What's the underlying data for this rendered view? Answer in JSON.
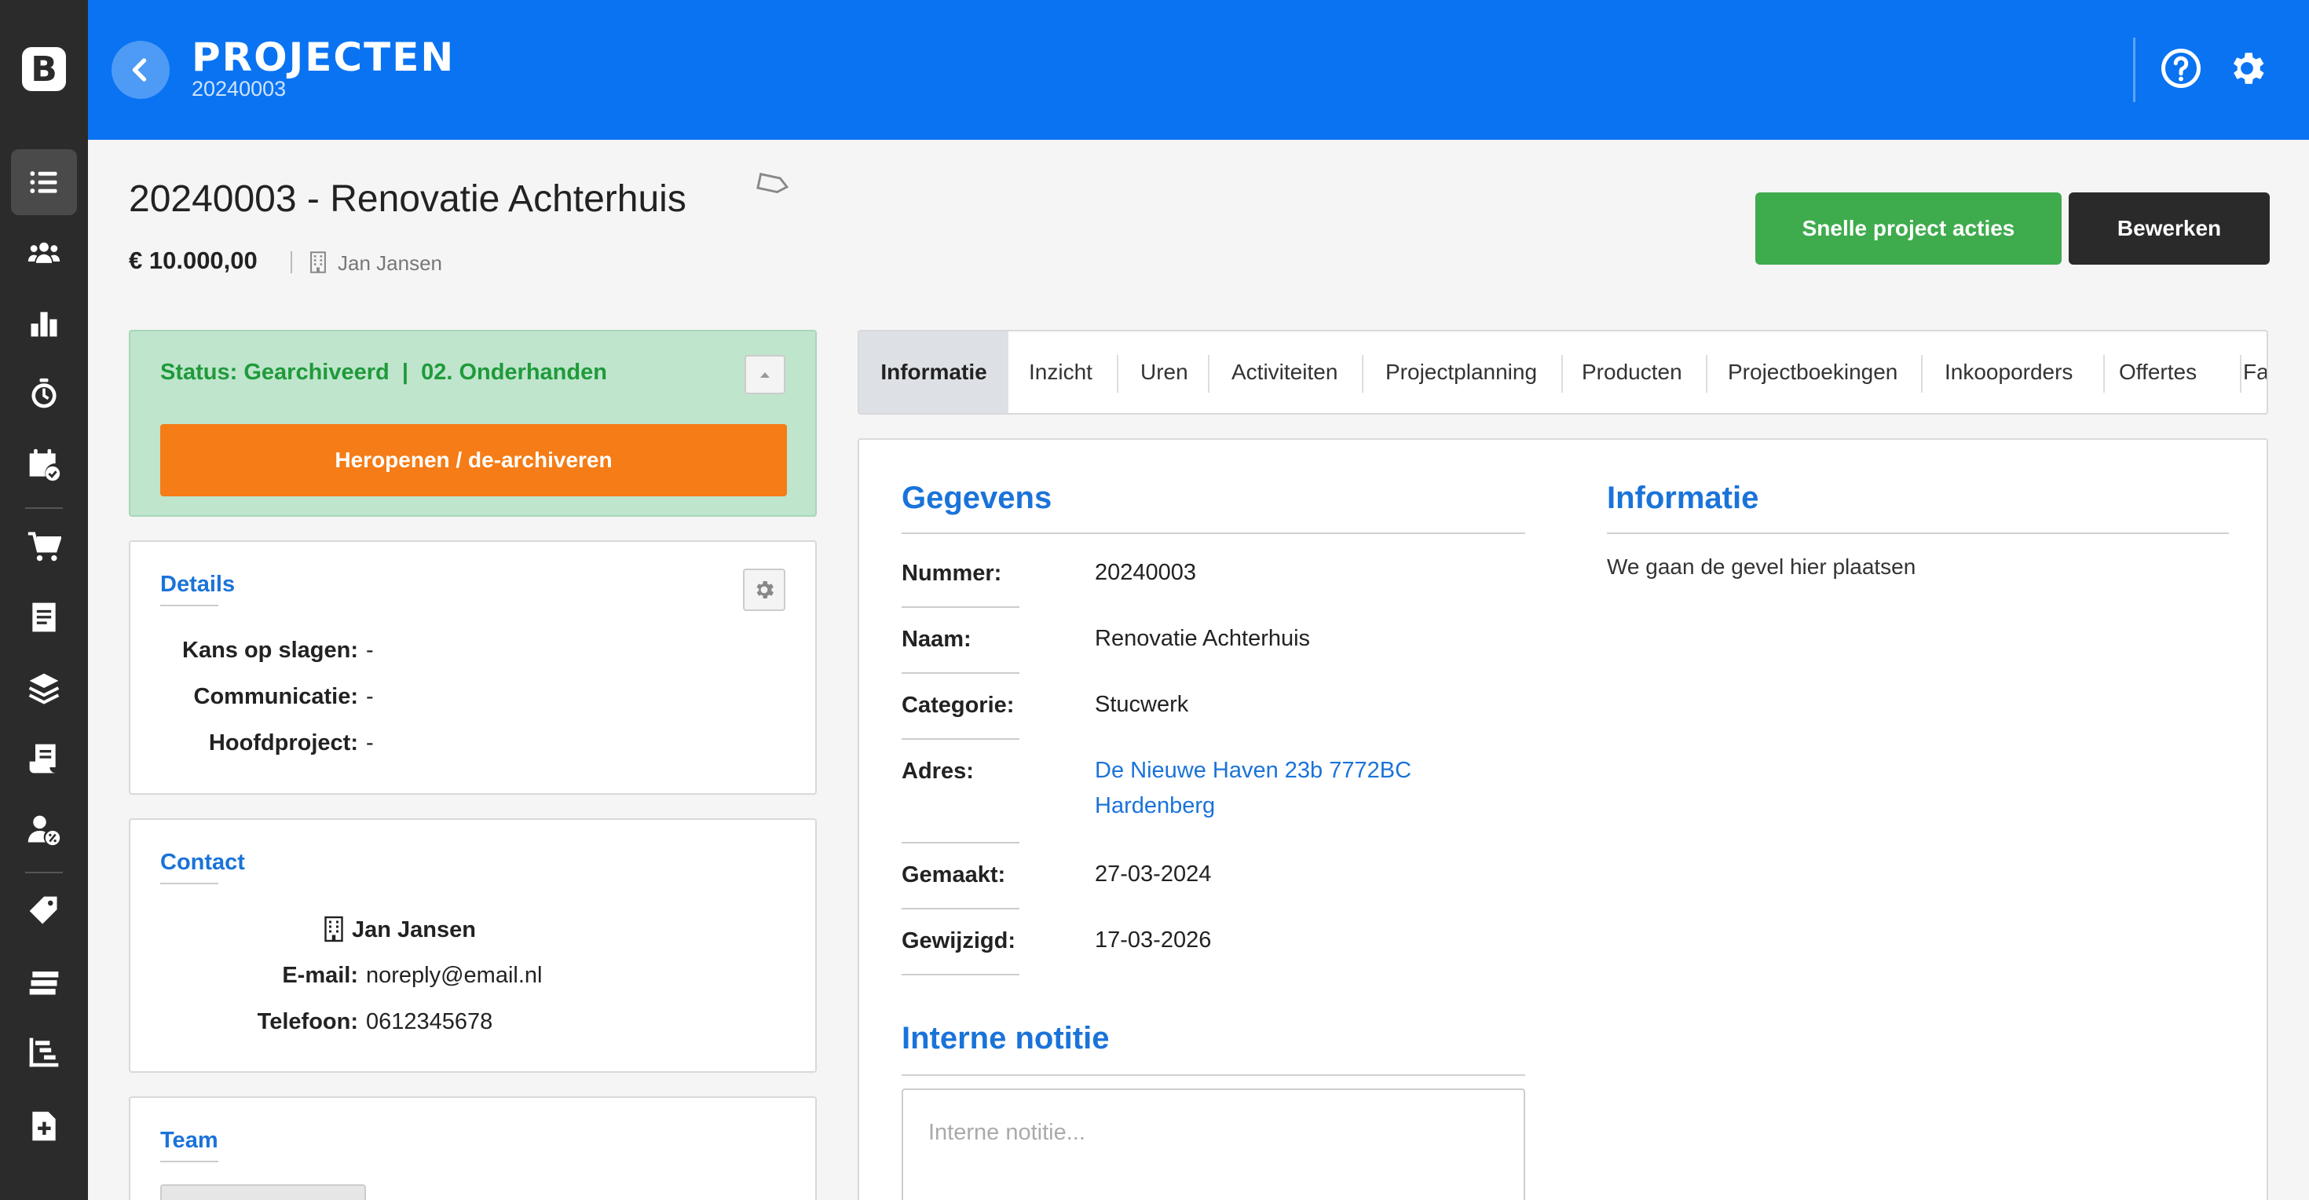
{
  "app": {
    "logo": "B",
    "title": "PROJECTEN",
    "subtitle": "20240003"
  },
  "sidebar": {
    "items": [
      {
        "name": "list-icon",
        "active": true
      },
      {
        "name": "users-icon"
      },
      {
        "name": "bar-chart-icon"
      },
      {
        "name": "stopwatch-icon"
      },
      {
        "name": "calendar-check-icon"
      },
      {
        "name": "cart-icon"
      },
      {
        "name": "document-icon"
      },
      {
        "name": "layers-icon"
      },
      {
        "name": "receipt-icon"
      },
      {
        "name": "user-percent-icon"
      },
      {
        "name": "tag-icon"
      },
      {
        "name": "stack-icon"
      },
      {
        "name": "gantt-icon"
      },
      {
        "name": "file-plus-icon"
      }
    ]
  },
  "header": {
    "help_icon": "help-icon",
    "settings_icon": "gear-icon"
  },
  "project": {
    "title": "20240003 - Renovatie Achterhuis",
    "price": "€ 10.000,00",
    "company": "Jan Jansen"
  },
  "actions": {
    "quick_actions": "Snelle project acties",
    "edit": "Bewerken"
  },
  "status": {
    "text": "Status: Gearchiveerd  |  02. Onderhanden",
    "reopen": "Heropenen / de-archiveren"
  },
  "details": {
    "title": "Details",
    "rows": [
      {
        "label": "Kans op slagen:",
        "value": "-"
      },
      {
        "label": "Communicatie:",
        "value": "-"
      },
      {
        "label": "Hoofdproject:",
        "value": "-"
      }
    ]
  },
  "contact": {
    "title": "Contact",
    "name": "Jan Jansen",
    "email_label": "E-mail:",
    "email": "noreply@email.nl",
    "phone_label": "Telefoon:",
    "phone": "0612345678"
  },
  "team": {
    "title": "Team"
  },
  "tabs": [
    {
      "label": "Informatie",
      "active": true
    },
    {
      "label": "Inzicht"
    },
    {
      "label": "Uren"
    },
    {
      "label": "Activiteiten"
    },
    {
      "label": "Projectplanning"
    },
    {
      "label": "Producten"
    },
    {
      "label": "Projectboekingen"
    },
    {
      "label": "Inkooporders"
    },
    {
      "label": "Offertes"
    },
    {
      "label": "Fa"
    }
  ],
  "gegevens": {
    "title": "Gegevens",
    "rows": [
      {
        "label": "Nummer:",
        "value": "20240003"
      },
      {
        "label": "Naam:",
        "value": "Renovatie Achterhuis"
      },
      {
        "label": "Categorie:",
        "value": "Stucwerk"
      },
      {
        "label": "Adres:",
        "value_line1": "De Nieuwe Haven 23b 7772BC",
        "value_line2": "Hardenberg"
      },
      {
        "label": "Gemaakt:",
        "value": "27-03-2024"
      },
      {
        "label": "Gewijzigd:",
        "value": "17-03-2026"
      }
    ]
  },
  "informatie": {
    "title": "Informatie",
    "text": "We gaan de gevel hier plaatsen"
  },
  "notitie": {
    "title": "Interne notitie",
    "placeholder": "Interne notitie..."
  },
  "colors": {
    "header_blue": "#0a73f2",
    "sidebar": "#2b2b2b",
    "green": "#3eab4d",
    "orange": "#f57c16",
    "link_blue": "#1a73d9"
  }
}
